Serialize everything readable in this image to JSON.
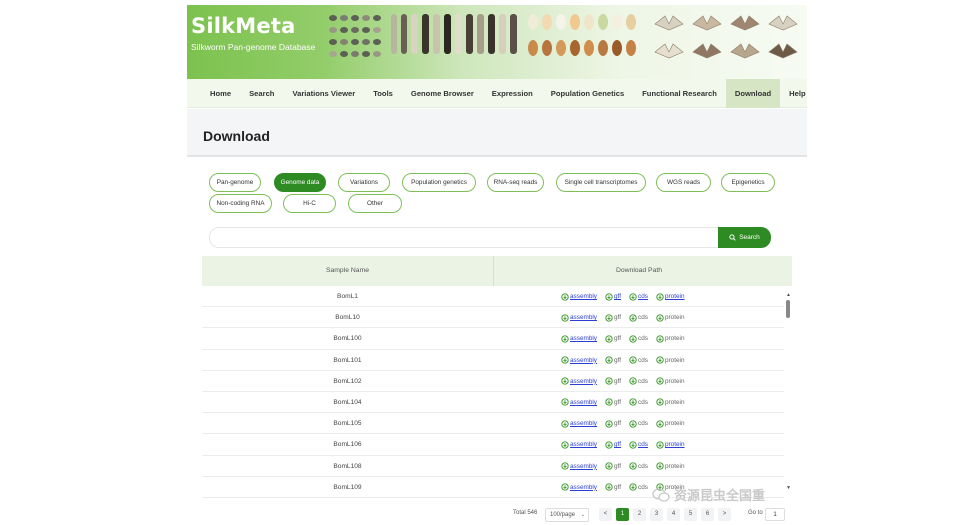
{
  "banner": {
    "logo_title": "SilkMeta",
    "logo_subtitle": "Silkworm Pan-genome Database"
  },
  "nav": {
    "items": [
      {
        "label": "Home"
      },
      {
        "label": "Search"
      },
      {
        "label": "Variations Viewer"
      },
      {
        "label": "Tools"
      },
      {
        "label": "Genome Browser"
      },
      {
        "label": "Expression"
      },
      {
        "label": "Population Genetics"
      },
      {
        "label": "Functional Research"
      },
      {
        "label": "Download",
        "active": true
      },
      {
        "label": "Help"
      }
    ]
  },
  "page": {
    "title": "Download"
  },
  "categories": [
    {
      "label": "Pan-genome"
    },
    {
      "label": "Genome data",
      "active": true
    },
    {
      "label": "Variations"
    },
    {
      "label": "Population genetics"
    },
    {
      "label": "RNA-seq reads"
    },
    {
      "label": "Single cell transcriptomes"
    },
    {
      "label": "WGS reads"
    },
    {
      "label": "Epigenetics"
    },
    {
      "label": "Non-coding RNA"
    },
    {
      "label": "Hi-C"
    },
    {
      "label": "Other"
    }
  ],
  "search": {
    "placeholder": "",
    "button_label": "Search",
    "icon": "search-icon"
  },
  "table": {
    "columns": [
      "Sample Name",
      "Download Path"
    ],
    "link_labels": [
      "assembly",
      "gff",
      "cds",
      "protein"
    ],
    "rows": [
      {
        "name": "BomL1",
        "linked": [
          true,
          true,
          true,
          true
        ]
      },
      {
        "name": "BomL10",
        "linked": [
          true,
          false,
          false,
          false
        ]
      },
      {
        "name": "BomL100",
        "linked": [
          true,
          false,
          false,
          false
        ]
      },
      {
        "name": "BomL101",
        "linked": [
          true,
          false,
          false,
          false
        ]
      },
      {
        "name": "BomL102",
        "linked": [
          true,
          false,
          false,
          false
        ]
      },
      {
        "name": "BomL104",
        "linked": [
          true,
          false,
          false,
          false
        ]
      },
      {
        "name": "BomL105",
        "linked": [
          true,
          false,
          false,
          false
        ]
      },
      {
        "name": "BomL106",
        "linked": [
          true,
          true,
          true,
          true
        ]
      },
      {
        "name": "BomL108",
        "linked": [
          true,
          false,
          false,
          false
        ]
      },
      {
        "name": "BomL109",
        "linked": [
          true,
          false,
          false,
          false
        ]
      }
    ]
  },
  "pagination": {
    "total": "Total 546",
    "page_size": "100/page",
    "pages": [
      "1",
      "2",
      "3",
      "4",
      "5",
      "6"
    ],
    "current_page": "1",
    "prev": "<",
    "next": ">",
    "goto_label": "Go to",
    "goto_value": "1"
  },
  "watermark": {
    "text": "资源昆虫全国重"
  },
  "colors": {
    "accent": "#2e8b23",
    "chip_border": "#7fbf5a",
    "link": "#2b3fd4",
    "header_bg": "#eaf3e4"
  }
}
